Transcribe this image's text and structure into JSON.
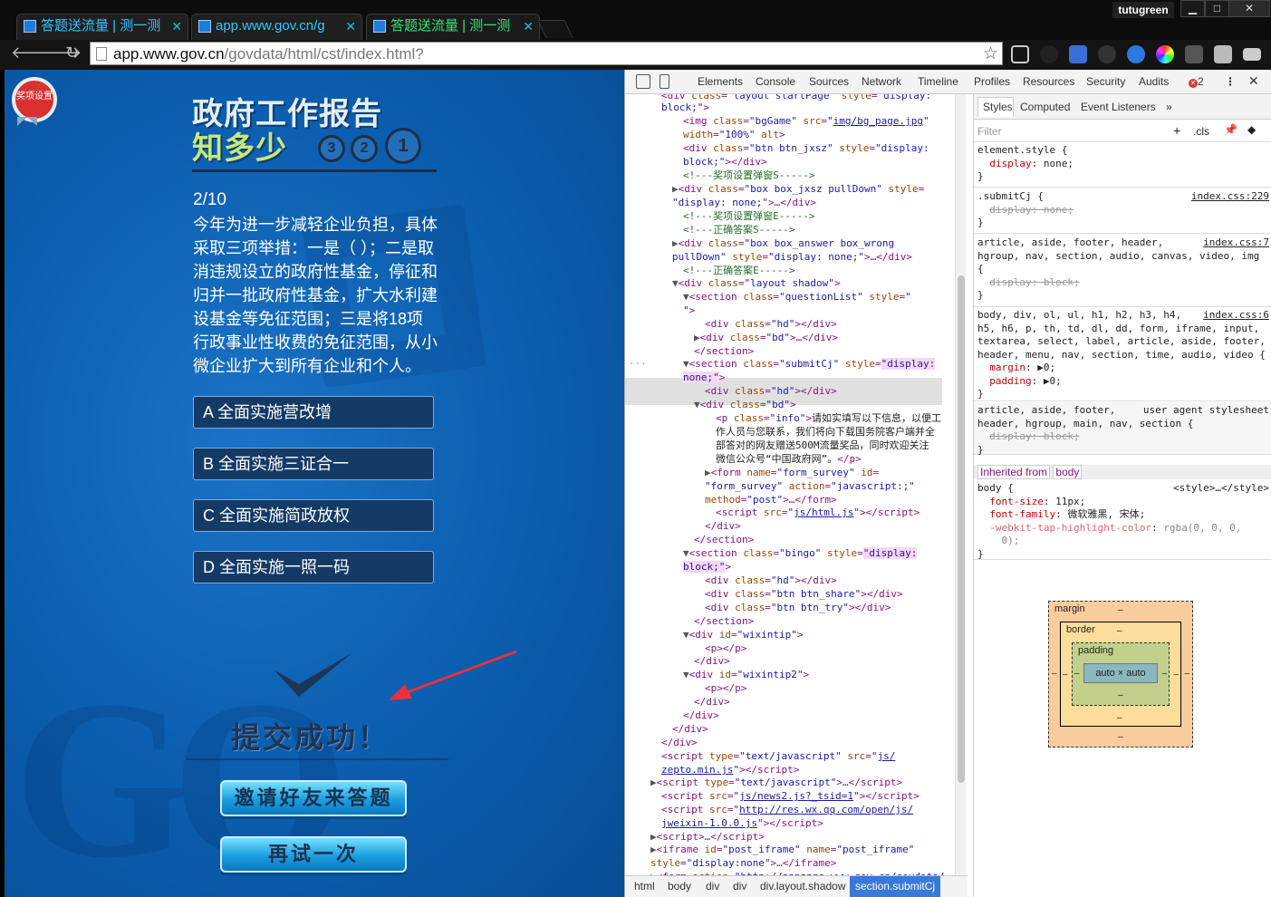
{
  "browser": {
    "tabs": [
      {
        "title": "答题送流量 | 测一测",
        "active": false
      },
      {
        "title": "app.www.gov.cn/g",
        "active": false
      },
      {
        "title": "答题送流量 | 测一测",
        "active": true
      }
    ],
    "user": "tutugreen",
    "url_host": "app.www.gov.cn",
    "url_path": "/govdata/html/cst/index.html?",
    "win_min": "▁",
    "win_max": "□",
    "win_close": "✕"
  },
  "page": {
    "badge": "奖项设置",
    "logo_line1": "政府工作报告",
    "logo_line2": "知多少",
    "medals": [
      "3",
      "2",
      "1"
    ],
    "progress": "2/10",
    "question": "今年为进一步减轻企业负担，具体采取三项举措：一是（ ）；二是取消违规设立的政府性基金，停征和归并一批政府性基金，扩大水利建设基金等免征范围；三是将18项行政事业性收费的免征范围，从小微企业扩大到所有企业和个人。",
    "options": [
      "A 全面实施营改增",
      "B 全面实施三证合一",
      "C 全面实施简政放权",
      "D 全面实施一照一码"
    ],
    "success": "提交成功！",
    "invite_button": "邀请好友来答题",
    "retry_button": "再试一次"
  },
  "devtools": {
    "tabs": [
      "Elements",
      "Console",
      "Sources",
      "Network",
      "Timeline",
      "Profiles",
      "Resources",
      "Security",
      "Audits"
    ],
    "error_count": "2",
    "breadcrumbs": [
      "html",
      "body",
      "div",
      "div",
      "div.layout.shadow",
      "section.submitCj"
    ],
    "styles_tabs": [
      "Styles",
      "Computed",
      "Event Listeners"
    ],
    "filter_placeholder": "Filter",
    "cls": ".cls",
    "inherited_label": "Inherited from",
    "inherited_tag": "body",
    "box_model": {
      "margin": "margin",
      "border": "border",
      "padding": "padding",
      "content": "auto × auto",
      "dash": "–"
    }
  }
}
